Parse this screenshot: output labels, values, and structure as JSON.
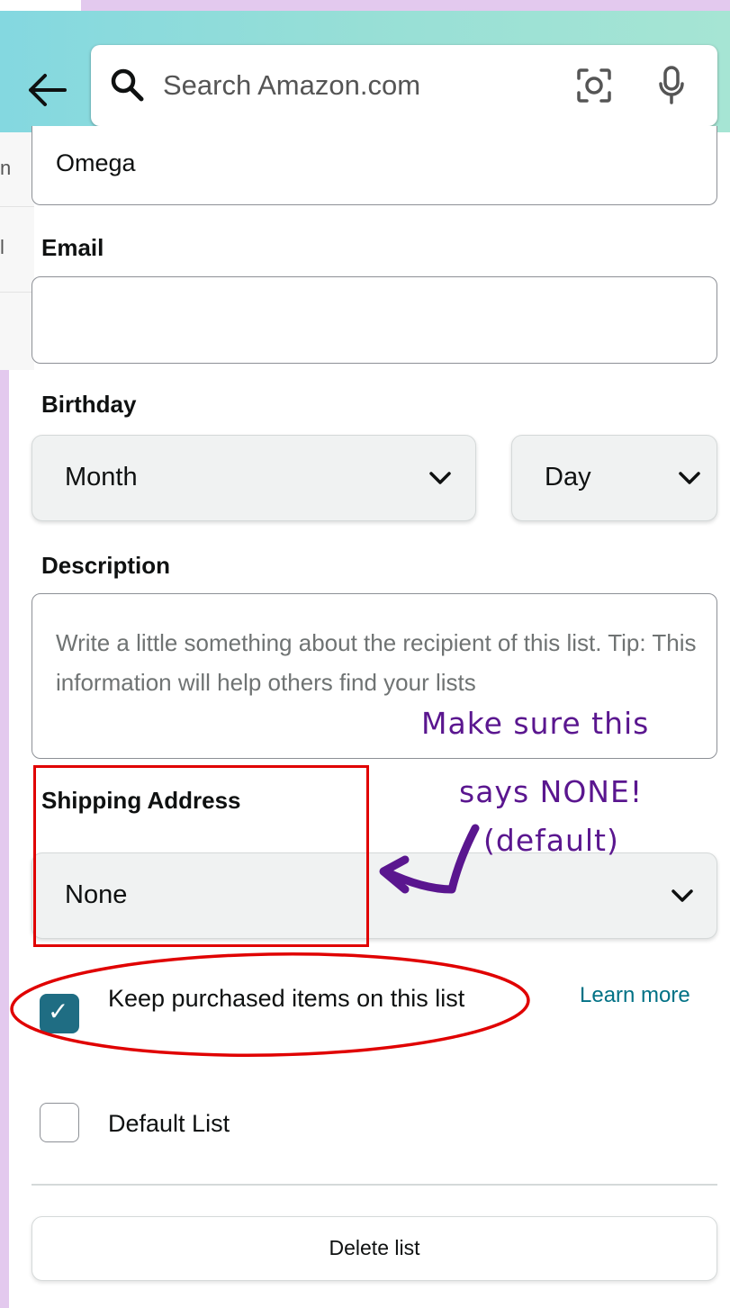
{
  "header": {
    "search_placeholder": "Search Amazon.com"
  },
  "background": {
    "peek_line1": "n",
    "peek_line2": "l"
  },
  "form": {
    "name_value": "Omega",
    "email_label": "Email",
    "email_value": "",
    "birthday_label": "Birthday",
    "month_value": "Month",
    "day_value": "Day",
    "description_label": "Description",
    "description_placeholder": "Write a little something about the recipient of this list. Tip: This information will help others find your lists",
    "shipping_label": "Shipping Address",
    "shipping_value": "None",
    "keep_purchased_label": "Keep purchased items on this list",
    "keep_purchased_checked": true,
    "learn_more": "Learn more",
    "default_list_label": "Default List",
    "default_list_checked": false,
    "delete_button": "Delete list"
  },
  "annotations": {
    "line1": "Make sure this",
    "line2": "says NONE!",
    "line3": "(default)",
    "color": "#5a168f",
    "highlight_color": "#e00000"
  },
  "colors": {
    "header_gradient_start": "#84d8e0",
    "header_gradient_end": "#a6e5d4",
    "checkbox_checked": "#1f6d83",
    "link": "#007185",
    "frame_lavender": "#e3c9ee"
  },
  "icons": [
    "back-arrow-icon",
    "search-icon",
    "camera-icon",
    "microphone-icon",
    "chevron-down-icon",
    "checkmark-icon"
  ]
}
